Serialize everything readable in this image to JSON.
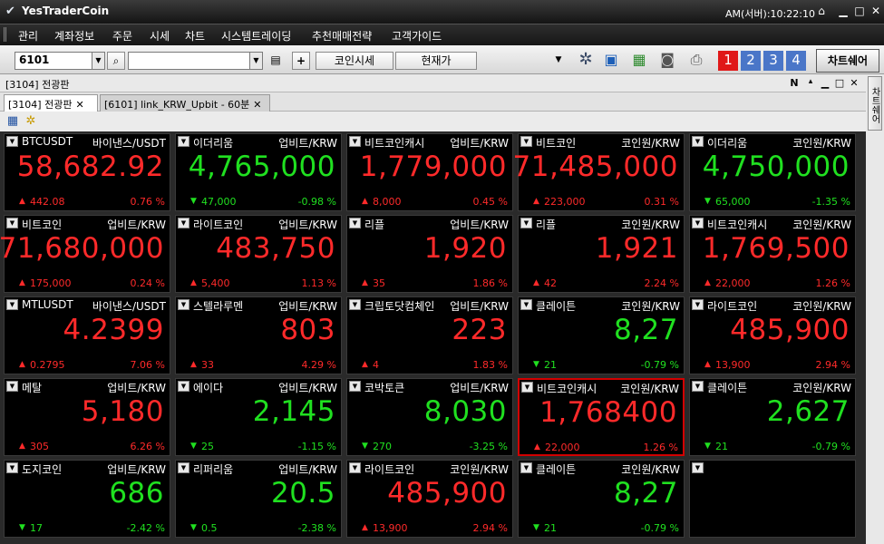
{
  "titlebar": {
    "app_title": "YesTraderCoin",
    "clock": "AM(서버):10:22:10"
  },
  "menu": [
    "관리",
    "계좌정보",
    "주문",
    "시세",
    "차트",
    "시스템트레이딩",
    "추천매매전략",
    "고객가이드"
  ],
  "toolbar": {
    "code_value": "6101",
    "search_value": "",
    "coin_quote_label": "코인시세",
    "current_price_label": "현재가",
    "workspace_numbers": [
      "1",
      "2",
      "3",
      "4"
    ],
    "chart_share_label": "차트쉐어"
  },
  "panel": {
    "title": "[3104] 전광판",
    "ctrl_n": "N"
  },
  "tabs": [
    {
      "label": "[3104] 전광판",
      "active": true
    },
    {
      "label": "[6101] link_KRW_Upbit - 60분",
      "active": false
    }
  ],
  "side_tab": "차트쉐어",
  "tiles": [
    {
      "name": "BTCUSDT",
      "exchange": "바이낸스/USDT",
      "price": "58,682.92",
      "change": "442.08",
      "pct": "0.76 %",
      "dir": "up"
    },
    {
      "name": "이더리움",
      "exchange": "업비트/KRW",
      "price": "4,765,000",
      "change": "47,000",
      "pct": "-0.98 %",
      "dir": "down"
    },
    {
      "name": "비트코인캐시",
      "exchange": "업비트/KRW",
      "price": "1,779,000",
      "change": "8,000",
      "pct": "0.45 %",
      "dir": "up"
    },
    {
      "name": "비트코인",
      "exchange": "코인원/KRW",
      "price": "71,485,000",
      "change": "223,000",
      "pct": "0.31 %",
      "dir": "up"
    },
    {
      "name": "이더리움",
      "exchange": "코인원/KRW",
      "price": "4,750,000",
      "change": "65,000",
      "pct": "-1.35 %",
      "dir": "down"
    },
    {
      "name": "비트코인",
      "exchange": "업비트/KRW",
      "price": "71,680,000",
      "change": "175,000",
      "pct": "0.24 %",
      "dir": "up"
    },
    {
      "name": "라이트코인",
      "exchange": "업비트/KRW",
      "price": "483,750",
      "change": "5,400",
      "pct": "1.13 %",
      "dir": "up"
    },
    {
      "name": "리플",
      "exchange": "업비트/KRW",
      "price": "1,920",
      "change": "35",
      "pct": "1.86 %",
      "dir": "up"
    },
    {
      "name": "리플",
      "exchange": "코인원/KRW",
      "price": "1,921",
      "change": "42",
      "pct": "2.24 %",
      "dir": "up"
    },
    {
      "name": "비트코인캐시",
      "exchange": "코인원/KRW",
      "price": "1,769,500",
      "change": "22,000",
      "pct": "1.26 %",
      "dir": "up"
    },
    {
      "name": "MTLUSDT",
      "exchange": "바이낸스/USDT",
      "price": "4.2399",
      "change": "0.2795",
      "pct": "7.06 %",
      "dir": "up"
    },
    {
      "name": "스텔라루멘",
      "exchange": "업비트/KRW",
      "price": "803",
      "change": "33",
      "pct": "4.29 %",
      "dir": "up"
    },
    {
      "name": "크립토닷컴체인",
      "exchange": "업비트/KRW",
      "price": "223",
      "change": "4",
      "pct": "1.83 %",
      "dir": "up"
    },
    {
      "name": "클레이튼",
      "exchange": "코인원/KRW",
      "price": "8,27",
      "change": "21",
      "pct": "-0.79 %",
      "dir": "down"
    },
    {
      "name": "라이트코인",
      "exchange": "코인원/KRW",
      "price": "485,900",
      "change": "13,900",
      "pct": "2.94 %",
      "dir": "up"
    },
    {
      "name": "메탈",
      "exchange": "업비트/KRW",
      "price": "5,180",
      "change": "305",
      "pct": "6.26 %",
      "dir": "up"
    },
    {
      "name": "에이다",
      "exchange": "업비트/KRW",
      "price": "2,145",
      "change": "25",
      "pct": "-1.15 %",
      "dir": "down"
    },
    {
      "name": "코박토큰",
      "exchange": "업비트/KRW",
      "price": "8,030",
      "change": "270",
      "pct": "-3.25 %",
      "dir": "down"
    },
    {
      "name": "비트코인캐시",
      "exchange": "코인원/KRW",
      "price": "1,768400",
      "change": "22,000",
      "pct": "1.26 %",
      "dir": "up"
    },
    {
      "name": "클레이튼",
      "exchange": "코인원/KRW",
      "price": "2,627",
      "change": "21",
      "pct": "-0.79 %",
      "dir": "down"
    },
    {
      "name": "도지코인",
      "exchange": "업비트/KRW",
      "price": "686",
      "change": "17",
      "pct": "-2.42 %",
      "dir": "down"
    },
    {
      "name": "리퍼리움",
      "exchange": "업비트/KRW",
      "price": "20.5",
      "change": "0.5",
      "pct": "-2.38 %",
      "dir": "down"
    },
    {
      "name": "라이트코인",
      "exchange": "코인원/KRW",
      "price": "485,900",
      "change": "13,900",
      "pct": "2.94 %",
      "dir": "up"
    },
    {
      "name": "클레이튼",
      "exchange": "코인원/KRW",
      "price": "8,27",
      "change": "21",
      "pct": "-0.79 %",
      "dir": "down"
    },
    {
      "name": "",
      "exchange": "",
      "price": "",
      "change": "",
      "pct": "",
      "dir": "none"
    }
  ],
  "selected_tile": 18,
  "colors": {
    "up": "#ff2a2a",
    "down": "#20e020",
    "selection": "#d20000",
    "num_red": "#e01818",
    "num_blue": "#4a76c8"
  }
}
